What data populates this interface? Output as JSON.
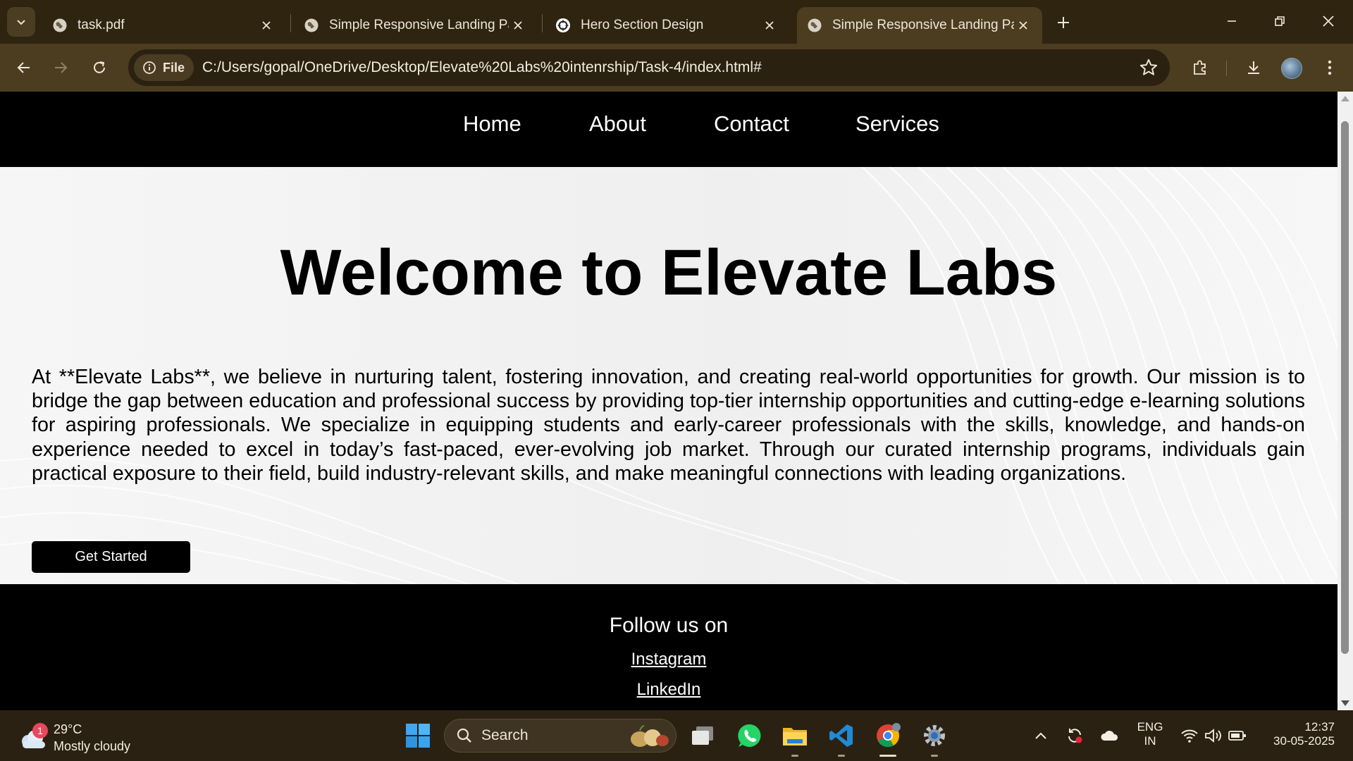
{
  "browser": {
    "tabs": [
      {
        "title": "task.pdf",
        "active": false
      },
      {
        "title": "Simple Responsive Landing Pag",
        "active": false
      },
      {
        "title": "Hero Section Design",
        "active": false
      },
      {
        "title": "Simple Responsive Landing Pag",
        "active": true
      }
    ],
    "security_chip": "File",
    "url": "C:/Users/gopal/OneDrive/Desktop/Elevate%20Labs%20intenrship/Task-4/index.html#"
  },
  "page": {
    "nav": [
      "Home",
      "About",
      "Contact",
      "Services"
    ],
    "hero": {
      "title": "Welcome to Elevate Labs",
      "paragraph": "At **Elevate Labs**, we believe in nurturing talent, fostering innovation, and creating real-world opportunities for growth. Our mission is to bridge the gap between education and professional success by providing top-tier internship opportunities and cutting-edge e-learning solutions for aspiring professionals. We specialize in equipping students and early-career professionals with the skills, knowledge, and hands-on experience needed to excel in today’s fast-paced, ever-evolving job market. Through our curated internship programs, individuals gain practical exposure to their field, build industry-relevant skills, and make meaningful connections with leading organizations.",
      "cta": "Get Started"
    },
    "footer": {
      "heading": "Follow us on",
      "links": [
        "Instagram",
        "LinkedIn"
      ]
    }
  },
  "taskbar": {
    "weather_badge": "1",
    "temperature": "29°C",
    "condition": "Mostly cloudy",
    "search_label": "Search",
    "lang_line1": "ENG",
    "lang_line2": "IN",
    "time": "12:37",
    "date": "30-05-2025"
  },
  "colors": {
    "chrome_dark": "#2e2410",
    "chrome_toolbar": "#4c3d20",
    "page_nav": "#000000",
    "hero_bg": "#f3f3f3",
    "taskbar": "#2b2112"
  }
}
